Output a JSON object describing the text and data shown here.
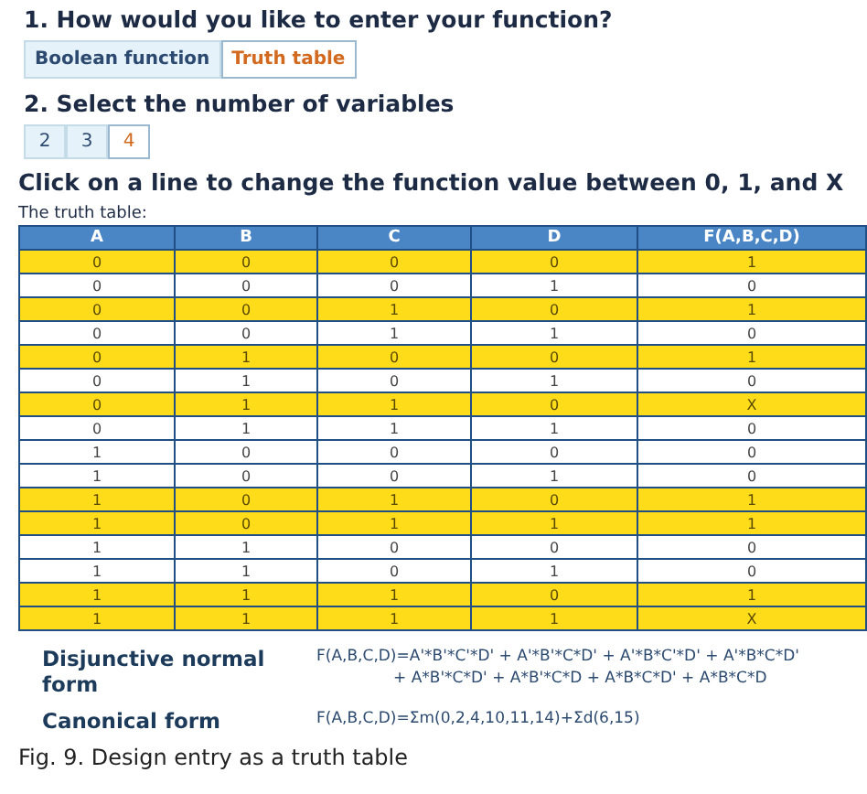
{
  "step1": {
    "heading": "1. How would you like to enter your function?",
    "options": [
      {
        "label": "Boolean function",
        "selected": false
      },
      {
        "label": "Truth table",
        "selected": true
      }
    ]
  },
  "step2": {
    "heading": "2. Select the number of variables",
    "options": [
      {
        "label": "2",
        "selected": false
      },
      {
        "label": "3",
        "selected": false
      },
      {
        "label": "4",
        "selected": true
      }
    ]
  },
  "instruction": "Click on a line to change the function value between 0, 1, and X",
  "table": {
    "caption": "The truth table:",
    "columns": [
      "A",
      "B",
      "C",
      "D",
      "F(A,B,C,D)"
    ],
    "rows": [
      {
        "cells": [
          "0",
          "0",
          "0",
          "0",
          "1"
        ],
        "highlighted": true
      },
      {
        "cells": [
          "0",
          "0",
          "0",
          "1",
          "0"
        ],
        "highlighted": false
      },
      {
        "cells": [
          "0",
          "0",
          "1",
          "0",
          "1"
        ],
        "highlighted": true
      },
      {
        "cells": [
          "0",
          "0",
          "1",
          "1",
          "0"
        ],
        "highlighted": false
      },
      {
        "cells": [
          "0",
          "1",
          "0",
          "0",
          "1"
        ],
        "highlighted": true
      },
      {
        "cells": [
          "0",
          "1",
          "0",
          "1",
          "0"
        ],
        "highlighted": false
      },
      {
        "cells": [
          "0",
          "1",
          "1",
          "0",
          "X"
        ],
        "highlighted": true
      },
      {
        "cells": [
          "0",
          "1",
          "1",
          "1",
          "0"
        ],
        "highlighted": false
      },
      {
        "cells": [
          "1",
          "0",
          "0",
          "0",
          "0"
        ],
        "highlighted": false
      },
      {
        "cells": [
          "1",
          "0",
          "0",
          "1",
          "0"
        ],
        "highlighted": false
      },
      {
        "cells": [
          "1",
          "0",
          "1",
          "0",
          "1"
        ],
        "highlighted": true
      },
      {
        "cells": [
          "1",
          "0",
          "1",
          "1",
          "1"
        ],
        "highlighted": true
      },
      {
        "cells": [
          "1",
          "1",
          "0",
          "0",
          "0"
        ],
        "highlighted": false
      },
      {
        "cells": [
          "1",
          "1",
          "0",
          "1",
          "0"
        ],
        "highlighted": false
      },
      {
        "cells": [
          "1",
          "1",
          "1",
          "0",
          "1"
        ],
        "highlighted": true
      },
      {
        "cells": [
          "1",
          "1",
          "1",
          "1",
          "X"
        ],
        "highlighted": true
      }
    ]
  },
  "results": [
    {
      "label": "Disjunctive normal form",
      "lines": [
        "F(A,B,C,D)=A'*B'*C'*D' + A'*B'*C*D' + A'*B*C'*D' + A'*B*C*D'",
        "+ A*B'*C*D' + A*B'*C*D + A*B*C*D' + A*B*C*D"
      ]
    },
    {
      "label": "Canonical form",
      "lines": [
        "F(A,B,C,D)=Σm(0,2,4,10,11,14)+Σd(6,15)"
      ]
    }
  ],
  "figure_caption": "Fig. 9. Design entry as a truth table"
}
